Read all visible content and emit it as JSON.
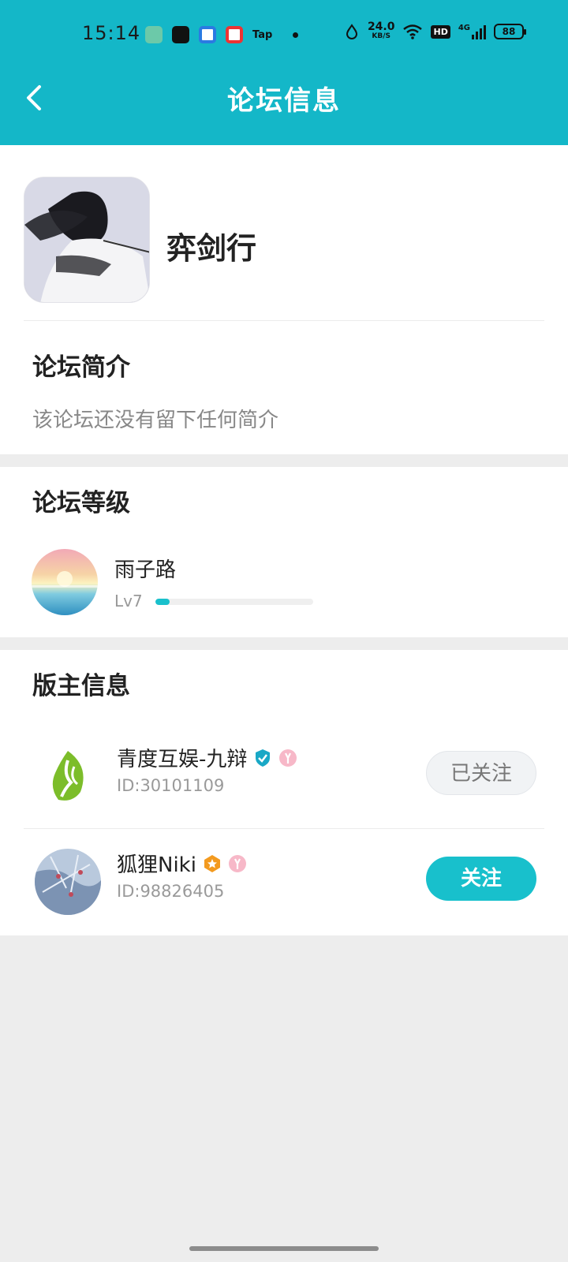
{
  "status_bar": {
    "time": "15:14",
    "net_speed_value": "24.0",
    "net_speed_unit": "KB/S",
    "hd_label": "HD",
    "signal_label": "4G",
    "battery": "88",
    "tap_label": "Tap"
  },
  "header": {
    "title": "论坛信息",
    "back_icon": "chevron-left-icon"
  },
  "forum": {
    "name": "弈剑行"
  },
  "intro": {
    "title": "论坛简介",
    "text": "该论坛还没有留下任何简介"
  },
  "level": {
    "title": "论坛等级",
    "user": "雨子路",
    "label": "Lv7",
    "progress": 0.09
  },
  "moderators": {
    "title": "版主信息",
    "items": [
      {
        "name": "青度互娱-九辩",
        "id": "ID:30101109",
        "button": "已关注"
      },
      {
        "name": "狐狸Niki",
        "id": "ID:98826405",
        "button": "关注"
      }
    ]
  },
  "colors": {
    "accent": "#14b7c8",
    "follow": "#18c0cc"
  }
}
